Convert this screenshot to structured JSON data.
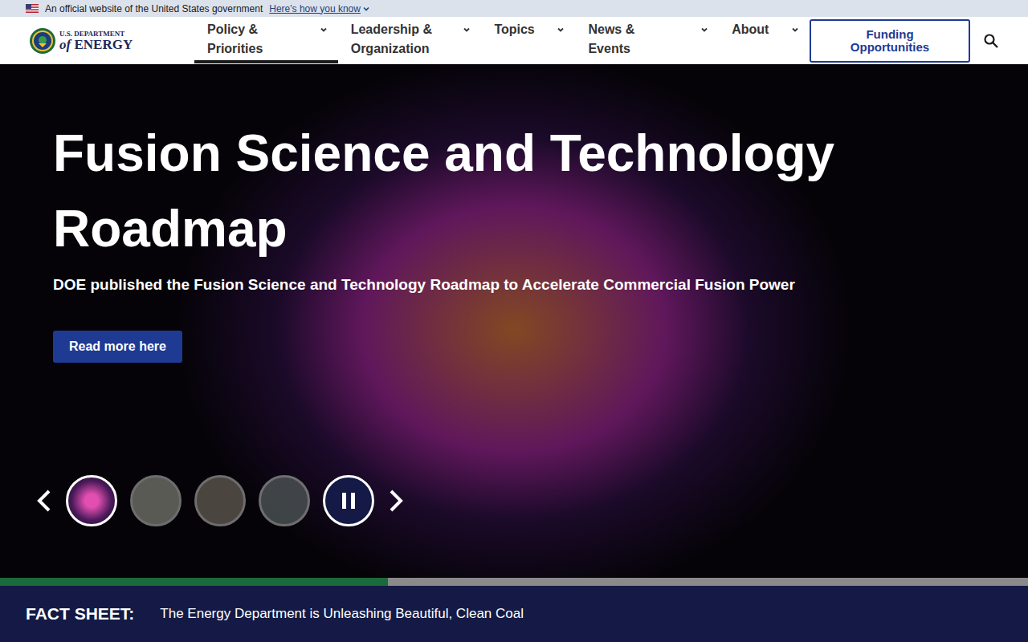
{
  "gov_banner": {
    "text": "An official website of the United States government",
    "link": "Here's how you know",
    "expanded": false
  },
  "logo": {
    "line1": "U.S. DEPARTMENT",
    "line2_prefix": "of",
    "line2": "ENERGY"
  },
  "nav": [
    {
      "label": "Policy & Priorities",
      "selected": true,
      "expanded": false
    },
    {
      "label": "Leadership & Organization",
      "selected": false,
      "expanded": false
    },
    {
      "label": "Topics",
      "selected": false,
      "expanded": false
    },
    {
      "label": "News & Events",
      "selected": false,
      "expanded": false
    },
    {
      "label": "About",
      "selected": false,
      "expanded": false
    }
  ],
  "funding_button": "Funding Opportunities",
  "hero": {
    "title": "Fusion Science and Technology Roadmap",
    "subtitle": "DOE published the Fusion Science and Technology Roadmap to Accelerate Commercial Fusion Power",
    "button": "Read more here"
  },
  "carousel": {
    "slides": [
      {
        "selected": true
      },
      {
        "selected": false
      },
      {
        "selected": false
      },
      {
        "selected": false
      }
    ],
    "playing": true
  },
  "progress": {
    "level": 0.377
  },
  "fact_sheet": {
    "label": "FACT SHEET:",
    "text": "The Energy Department is Unleashing Beautiful, Clean Coal"
  }
}
